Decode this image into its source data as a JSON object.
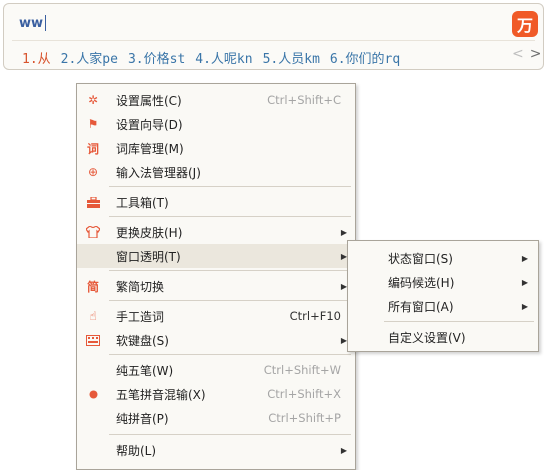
{
  "ime": {
    "typed": "ww",
    "logo_glyph": "万",
    "candidates": [
      "1.从",
      "2.人家pe",
      "3.价格st",
      "4.人呢kn",
      "5.人员km",
      "6.你们的rq"
    ],
    "prev_icon": "<",
    "next_icon": ">"
  },
  "menu": {
    "items": [
      {
        "label": "设置属性(C)",
        "shortcut": "Ctrl+Shift+C",
        "icon": "gear-icon"
      },
      {
        "label": "设置向导(D)",
        "icon": "flag-icon"
      },
      {
        "label": "词库管理(M)",
        "icon": "dictionary-icon"
      },
      {
        "label": "输入法管理器(J)",
        "icon": "plus-circle-icon"
      },
      {
        "label": "工具箱(T)",
        "icon": "toolbox-icon"
      },
      {
        "label": "更换皮肤(H)",
        "icon": "shirt-icon",
        "arrow": "▶"
      },
      {
        "label": "窗口透明(T)",
        "arrow": "▶"
      },
      {
        "label": "繁简切换",
        "icon": "convert-icon",
        "arrow": "▶"
      },
      {
        "label": "手工造词",
        "shortcut": "Ctrl+F10",
        "icon": "thumb-icon"
      },
      {
        "label": "软键盘(S)",
        "icon": "keyboard-icon",
        "arrow": "▶"
      },
      {
        "label": "纯五笔(W)",
        "shortcut": "Ctrl+Shift+W"
      },
      {
        "label": "五笔拼音混输(X)",
        "shortcut": "Ctrl+Shift+X",
        "icon": "dot-icon"
      },
      {
        "label": "纯拼音(P)",
        "shortcut": "Ctrl+Shift+P"
      },
      {
        "label": "帮助(L)",
        "arrow": "▶"
      }
    ]
  },
  "submenu": {
    "items": [
      {
        "label": "状态窗口(S)",
        "arrow": "▶"
      },
      {
        "label": "编码候选(H)",
        "arrow": "▶"
      },
      {
        "label": "所有窗口(A)",
        "arrow": "▶"
      },
      {
        "label": "自定义设置(V)"
      }
    ]
  },
  "colors": {
    "accent": "#f05a28",
    "candidate_first": "#d8542e",
    "candidate": "#3a75a8",
    "menu_icon": "#e6593a"
  }
}
